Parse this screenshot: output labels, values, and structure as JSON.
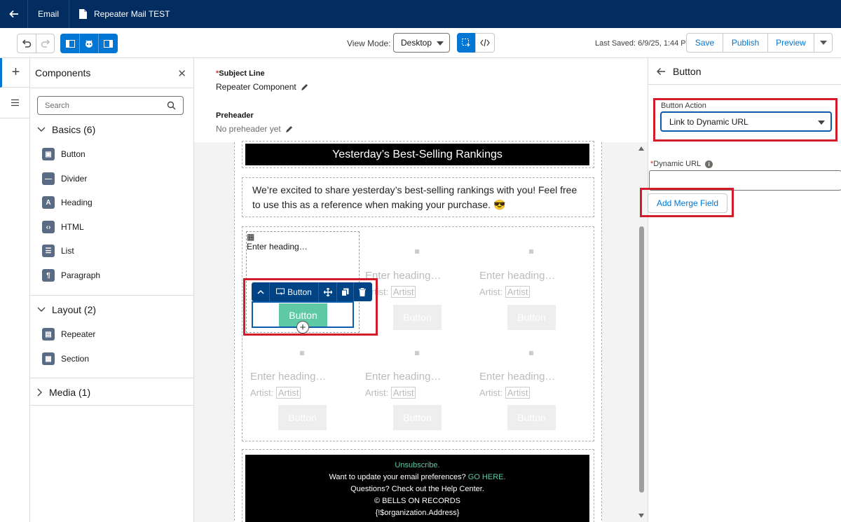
{
  "topbar": {
    "tab_email": "Email",
    "doc_title": "Repeater Mail TEST"
  },
  "toolbar": {
    "view_mode_label": "View Mode:",
    "view_mode_value": "Desktop",
    "last_saved": "Last Saved: 6/9/25, 1:44 PM",
    "save": "Save",
    "publish": "Publish",
    "preview": "Preview"
  },
  "components": {
    "title": "Components",
    "search_placeholder": "Search",
    "basics": {
      "label": "Basics (6)",
      "items": [
        "Button",
        "Divider",
        "Heading",
        "HTML",
        "List",
        "Paragraph"
      ]
    },
    "layout": {
      "label": "Layout (2)",
      "items": [
        "Repeater",
        "Section"
      ]
    },
    "media": {
      "label": "Media (1)"
    }
  },
  "meta": {
    "subject_label": "Subject Line",
    "subject_value": "Repeater Component",
    "preheader_label": "Preheader",
    "preheader_value": "No preheader yet"
  },
  "email": {
    "banner": "Yesterday’s Best-Selling Rankings",
    "intro": "We’re excited to share yesterday’s best-selling rankings with you! Feel free to use this as a reference when making your purchase.",
    "intro_emoji": "😎",
    "cell_heading": "Enter heading…",
    "cell_artist_prefix": "Artist:",
    "cell_artist_value": "Artist",
    "cell_button": "Button",
    "selected_toolbar_label": "Button",
    "selected_button": "Button",
    "footer": {
      "unsubscribe": "Unsubscribe.",
      "prefs_text": "Want to update your email preferences?",
      "prefs_link": "GO HERE.",
      "help": "Questions? Check out the Help Center.",
      "copyright": "© BELLS ON RECORDS",
      "address": "{!$organization.Address}"
    }
  },
  "properties": {
    "title": "Button",
    "button_action_label": "Button Action",
    "button_action_value": "Link to Dynamic URL",
    "dynamic_url_label": "Dynamic URL",
    "add_merge_field": "Add Merge Field"
  },
  "colors": {
    "topbar": "#032d60",
    "brand": "#0176d3",
    "highlight": "#d11c2a",
    "selected_button": "#5fc9a6"
  }
}
